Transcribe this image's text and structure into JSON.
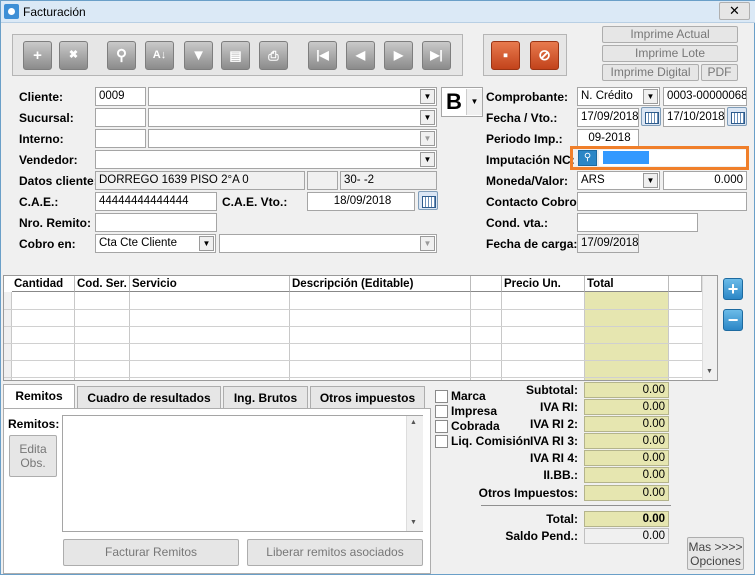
{
  "window": {
    "title": "Facturación",
    "close": "✕"
  },
  "print_buttons": {
    "imprime_actual": "Imprime Actual",
    "imprime_lote": "Imprime Lote",
    "imprime_digital": "Imprime Digital",
    "pdf": "PDF"
  },
  "comprobante_letra": "B",
  "form": {
    "cliente_label": "Cliente:",
    "cliente_code": "0009",
    "cliente_name": "",
    "sucursal_label": "Sucursal:",
    "interno_label": "Interno:",
    "vendedor_label": "Vendedor:",
    "datos_label": "Datos cliente:",
    "datos_address": "DORREGO 1639 PISO 2°A 0",
    "datos_cuit": "30-                   -2",
    "cae_label": "C.A.E.:",
    "cae_value": "44444444444444",
    "cae_vto_label": "C.A.E. Vto.:",
    "cae_vto_value": "18/09/2018",
    "remito_label": "Nro. Remito:",
    "cobro_label": "Cobro en:",
    "cobro_value": "Cta Cte Cliente",
    "comprobante_label": "Comprobante:",
    "comprobante_value": "N. Crédito",
    "comprobante_number": "0003-00000068",
    "fecha_label": "Fecha / Vto.:",
    "fecha_value": "17/09/2018",
    "vto_value": "17/10/2018",
    "periodo_label": "Periodo Imp.:",
    "periodo_value": "09-2018",
    "imputacion_label": "Imputación NC:",
    "moneda_label": "Moneda/Valor:",
    "moneda_value": "ARS",
    "valor": "0.000",
    "contacto_label": "Contacto Cobro:",
    "cond_label": "Cond. vta.:",
    "fecha_carga_label": "Fecha de carga:",
    "fecha_carga_value": "17/09/2018"
  },
  "grid": {
    "columns": [
      "Cantidad",
      "Cod. Ser.",
      "Servicio",
      "Descripción (Editable)",
      "Precio Un.",
      "Total"
    ]
  },
  "tabs": [
    "Remitos",
    "Cuadro de resultados",
    "Ing. Brutos",
    "Otros impuestos"
  ],
  "remitos": {
    "label": "Remitos:",
    "edita_obs": "Edita\nObs.",
    "facturar": "Facturar Remitos",
    "liberar": "Liberar remitos asociados"
  },
  "checks": [
    "Marca",
    "Impresa",
    "Cobrada",
    "Liq. Comisión"
  ],
  "totals": [
    {
      "label": "Subtotal:",
      "value": "0.00"
    },
    {
      "label": "IVA RI:",
      "value": "0.00"
    },
    {
      "label": "IVA RI 2:",
      "value": "0.00"
    },
    {
      "label": "IVA RI 3:",
      "value": "0.00"
    },
    {
      "label": "IVA RI 4:",
      "value": "0.00"
    },
    {
      "label": "II.BB.:",
      "value": "0.00"
    },
    {
      "label": "Otros Impuestos:",
      "value": "0.00"
    }
  ],
  "total": {
    "label": "Total:",
    "value": "0.00"
  },
  "saldo": {
    "label": "Saldo Pend.:",
    "value": "0.00"
  },
  "mas_opciones": "Mas >>>>\nOpciones",
  "colors": {
    "highlight": "#f07f2a",
    "selection": "#3399ff",
    "total_bg": "#e6e6b0"
  }
}
